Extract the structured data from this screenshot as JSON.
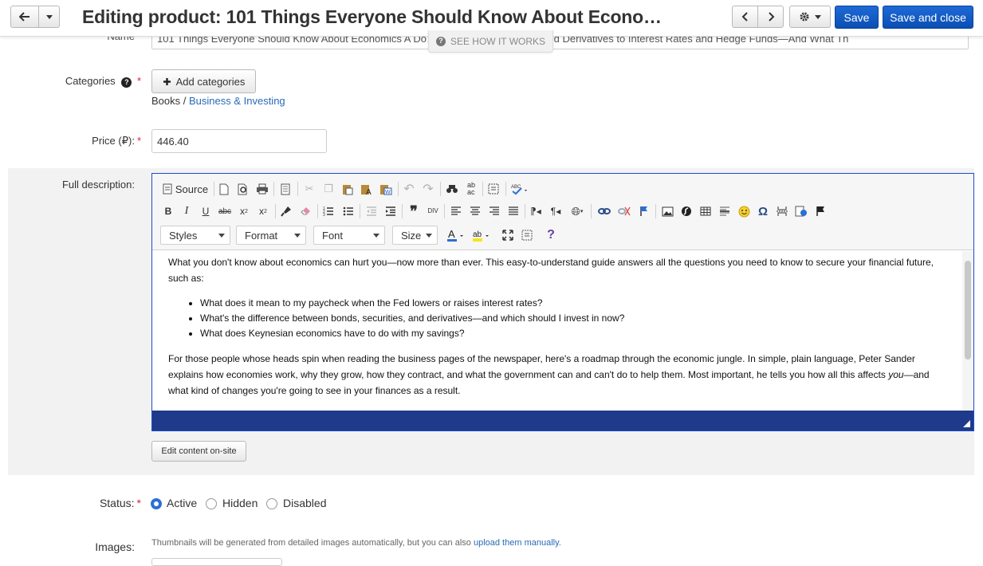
{
  "header": {
    "title": "Editing product: 101 Things Everyone Should Know About Econo…",
    "save_label": "Save",
    "save_close_label": "Save and close",
    "icons": [
      "arrow-left-icon",
      "caret-down-icon",
      "chevron-left-icon",
      "chevron-right-icon",
      "gear-icon"
    ]
  },
  "overlay": {
    "see_how_label": "SEE HOW IT WORKS"
  },
  "form": {
    "name_label": "Name",
    "name_value": "101 Things Everyone Should Know About Economics A Do… ything from Securities and Derivatives to Interest Rates and Hedge Funds—And What Th",
    "categories_label": "Categories",
    "add_categories_label": "Add categories",
    "category_path": {
      "parent": "Books",
      "separator": " / ",
      "child": "Business & Investing"
    },
    "price_label": "Price (₽):",
    "price_value": "446.40",
    "description_label": "Full description:",
    "edit_onsite_label": "Edit content on-site",
    "status_label": "Status:",
    "status_options": [
      {
        "label": "Active",
        "selected": true
      },
      {
        "label": "Hidden",
        "selected": false
      },
      {
        "label": "Disabled",
        "selected": false
      }
    ],
    "images_label": "Images:",
    "images_note": "Thumbnails will be generated from detailed images automatically, but you can also ",
    "images_link": "upload them manually",
    "images_note_end": "."
  },
  "editor": {
    "source_label": "Source",
    "combos": [
      "Styles",
      "Format",
      "Font",
      "Size"
    ],
    "intro": "What you don't know about economics can hurt you—now more than ever. This easy-to-understand guide answers all the questions you need to know to secure your financial future, such as:",
    "bullets": [
      "What does it mean to my paycheck when the Fed lowers or raises interest rates?",
      "What's the difference between bonds, securities, and derivatives—and which should I invest in now?",
      "What does Keynesian economics have to do with my savings?"
    ],
    "para2_a": "For those people whose heads spin when reading the business pages of the newspaper, here's a roadmap through the economic jungle. In simple, plain language, Peter Sander explains how economies work, why they grow, how they contract, and what the government can and can't do to help them. Most important, he tells you how all this affects ",
    "para2_em": "you",
    "para2_b": "—and what kind of changes you're going to see in your finances as a result."
  },
  "colors": {
    "primary": "#0b4fb3",
    "editor_status": "#1f3a8a",
    "link": "#2a6ab8",
    "required": "#dd2233"
  }
}
